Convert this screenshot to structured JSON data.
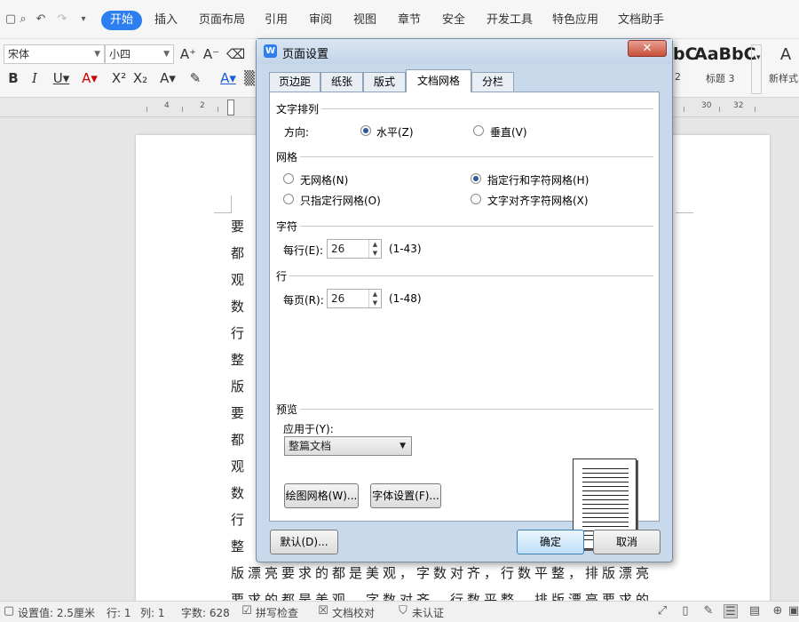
{
  "menubar": {
    "items": [
      "开始",
      "插入",
      "页面布局",
      "引用",
      "审阅",
      "视图",
      "章节",
      "安全",
      "开发工具",
      "特色应用",
      "文档助手"
    ],
    "active": "开始"
  },
  "ribbon": {
    "font_name": "宋体",
    "font_size": "小四",
    "style_preview_1": "bC",
    "style_preview_2": "AaBbC",
    "style_label_1": "2",
    "style_label_2": "标题 3",
    "new_style_label": "新样式"
  },
  "ruler": {
    "labels": [
      "4",
      "2",
      "30",
      "32"
    ]
  },
  "document": {
    "lines": [
      "要 求",
      "都 是",
      "观 ，",
      "数 对",
      "行 数",
      "整 ，",
      "版 漂",
      "要 求",
      "都 是",
      "观 ，",
      "数 对",
      "行 数",
      "整 ，",
      "版漂亮要求的都是美观，字数对齐，行数平整，排版漂亮",
      "要求的都是美观，字数对齐，行数平整，排版漂亮要求的"
    ]
  },
  "dialog": {
    "title": "页面设置",
    "close_label": "✕",
    "tabs": [
      "页边距",
      "纸张",
      "版式",
      "文档网格",
      "分栏"
    ],
    "selected_tab": "文档网格",
    "section_text_direction": "文字排列",
    "direction_label": "方向:",
    "direction_horizontal": "水平(Z)",
    "direction_vertical": "垂直(V)",
    "section_grid": "网格",
    "grid_none": "无网格(N)",
    "grid_line_char": "指定行和字符网格(H)",
    "grid_line_only": "只指定行网格(O)",
    "grid_char_align": "文字对齐字符网格(X)",
    "section_chars": "字符",
    "per_line_label": "每行(E):",
    "per_line_value": "26",
    "per_line_range": "(1-43)",
    "section_lines": "行",
    "per_page_label": "每页(R):",
    "per_page_value": "26",
    "per_page_range": "(1-48)",
    "section_preview": "预览",
    "apply_to_label": "应用于(Y):",
    "apply_to_value": "整篇文档",
    "draw_grid_button": "绘图网格(W)...",
    "font_settings_button": "字体设置(F)...",
    "default_button": "默认(D)...",
    "ok_button": "确定",
    "cancel_button": "取消"
  },
  "statusbar": {
    "setting_value": "设置值: 2.5厘米",
    "row": "行: 1",
    "col": "列: 1",
    "word_count": "字数: 628",
    "spell_check": "拼写检查",
    "doc_proof": "文档校对",
    "unverified": "未认证"
  },
  "colors": {
    "accent": "#2d7ff0",
    "close_button": "#c74f3b",
    "dialog_frame": "#c9d9ec"
  }
}
